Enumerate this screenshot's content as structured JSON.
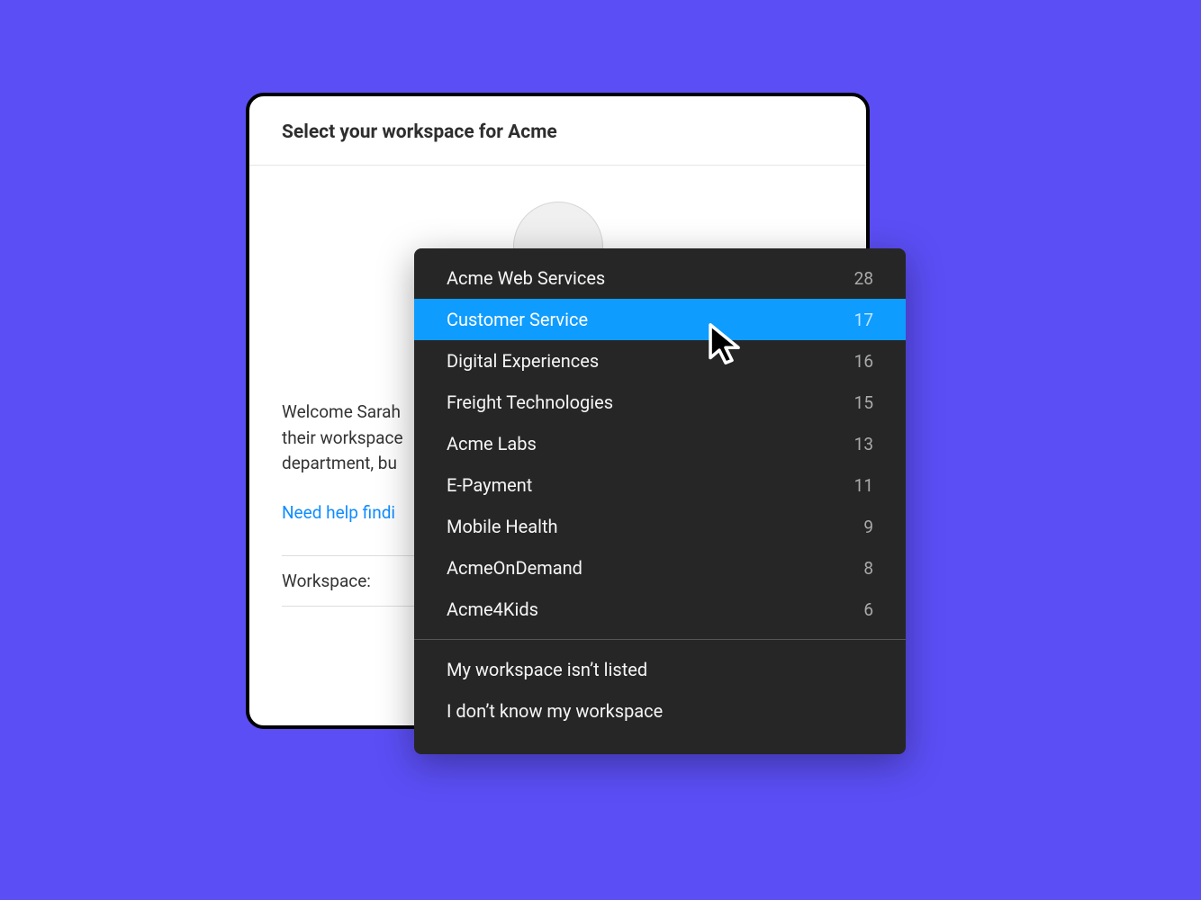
{
  "modal": {
    "title": "Select your workspace for Acme",
    "welcome_text": "Welcome Sarah\ntheir workspace\ndepartment, bu",
    "help_link": "Need help findi",
    "workspace_label": "Workspace:"
  },
  "dropdown": {
    "items": [
      {
        "label": "Acme Web Services",
        "count": "28"
      },
      {
        "label": "Customer Service",
        "count": "17"
      },
      {
        "label": "Digital Experiences",
        "count": "16"
      },
      {
        "label": "Freight Technologies",
        "count": "15"
      },
      {
        "label": "Acme Labs",
        "count": "13"
      },
      {
        "label": "E-Payment",
        "count": "11"
      },
      {
        "label": "Mobile Health",
        "count": "9"
      },
      {
        "label": "AcmeOnDemand",
        "count": "8"
      },
      {
        "label": "Acme4Kids",
        "count": "6"
      }
    ],
    "highlighted_index": 1,
    "footer": [
      {
        "label": "My workspace isn’t listed"
      },
      {
        "label": "I don’t know my workspace"
      }
    ]
  }
}
